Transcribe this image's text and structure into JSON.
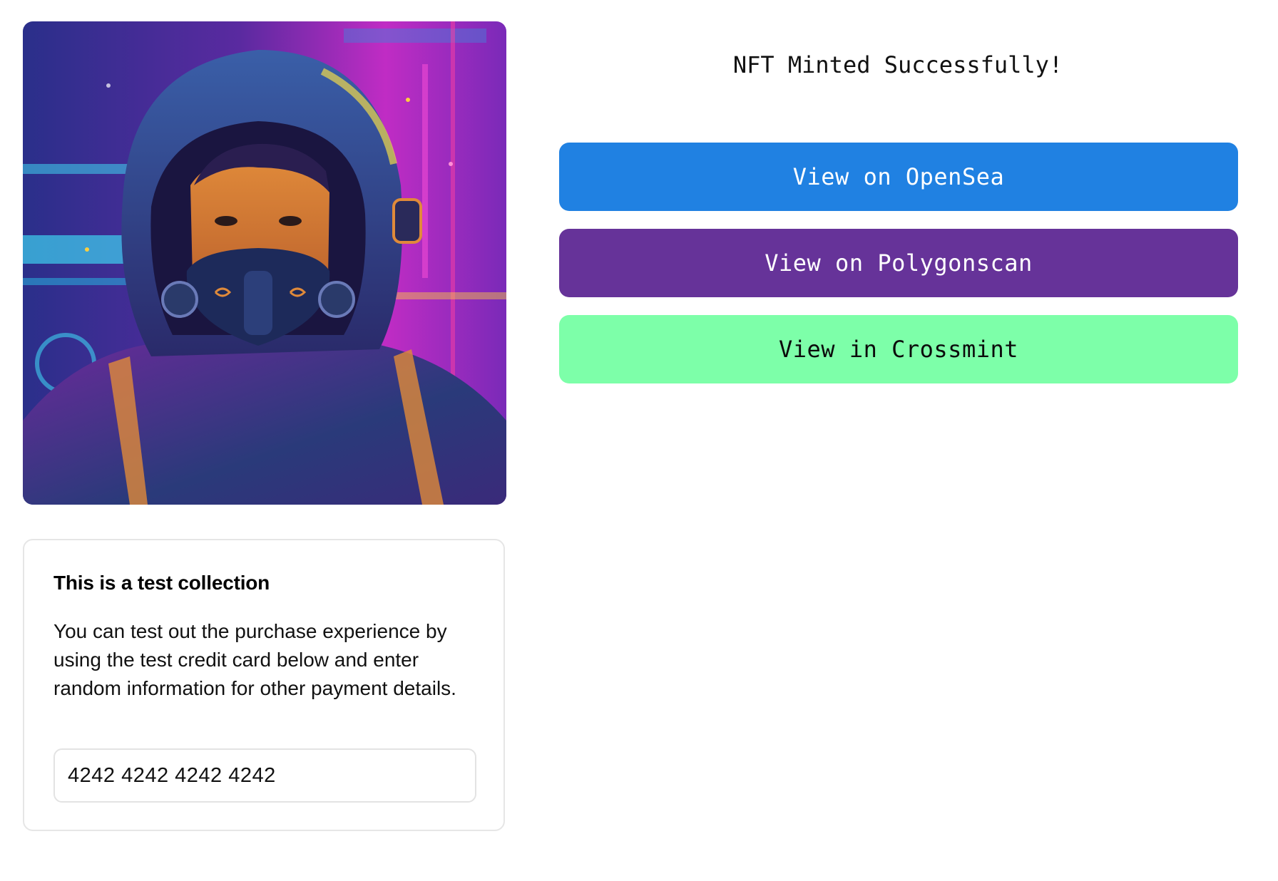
{
  "nft": {
    "image_description_icon": "nft-artwork-icon"
  },
  "info_card": {
    "title": "This is a test collection",
    "body": "You can test out the purchase experience by using the test credit card below and enter random information for other payment details.",
    "test_card_number": "4242 4242 4242 4242"
  },
  "result": {
    "heading": "NFT Minted Successfully!",
    "buttons": [
      {
        "label": "View on OpenSea",
        "color": "#2081e2",
        "text_color": "#ffffff"
      },
      {
        "label": "View on Polygonscan",
        "color": "#663399",
        "text_color": "#ffffff"
      },
      {
        "label": "View in Crossmint",
        "color": "#7dffa9",
        "text_color": "#0b0b0b"
      }
    ]
  }
}
